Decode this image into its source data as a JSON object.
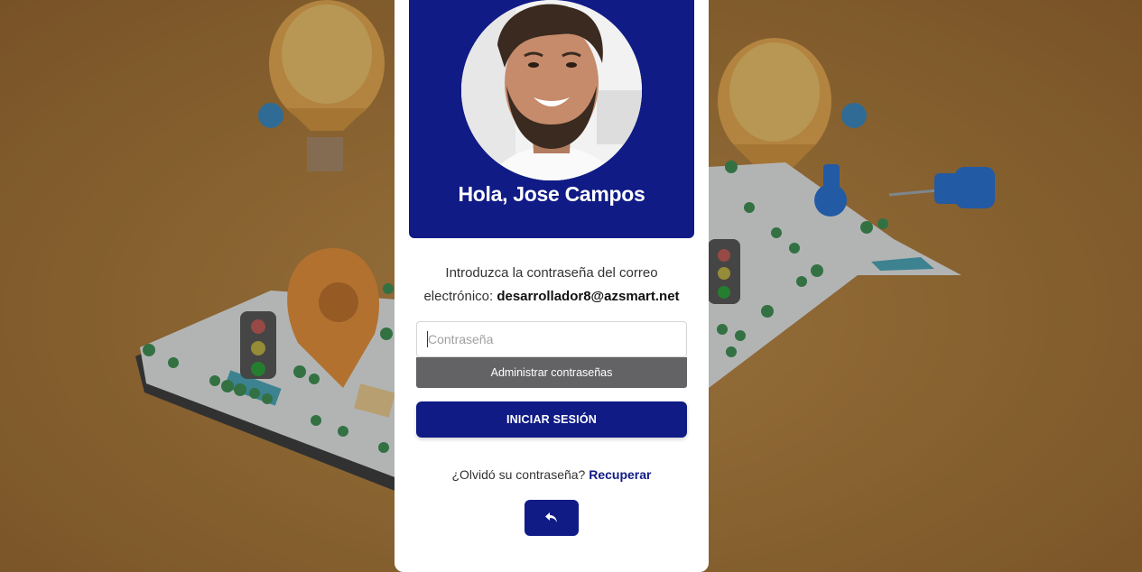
{
  "profile": {
    "greeting": "Hola, Jose Campos"
  },
  "login": {
    "intro_text": "Introduzca la contraseña del correo electrónico: ",
    "email": "desarrollador8@azsmart.net",
    "password_placeholder": "Contraseña",
    "password_value": "",
    "manage_passwords_label": "Administrar contraseñas",
    "submit_label": "INICIAR SESIÓN",
    "forgot_text": "¿Olvidó su contraseña? ",
    "recover_label": "Recuperar"
  },
  "icons": {
    "back": "undo-arrow-icon"
  },
  "colors": {
    "primary": "#101b86",
    "background": "#a87a3c",
    "autofill_bar": "#636366",
    "card": "#ffffff"
  }
}
